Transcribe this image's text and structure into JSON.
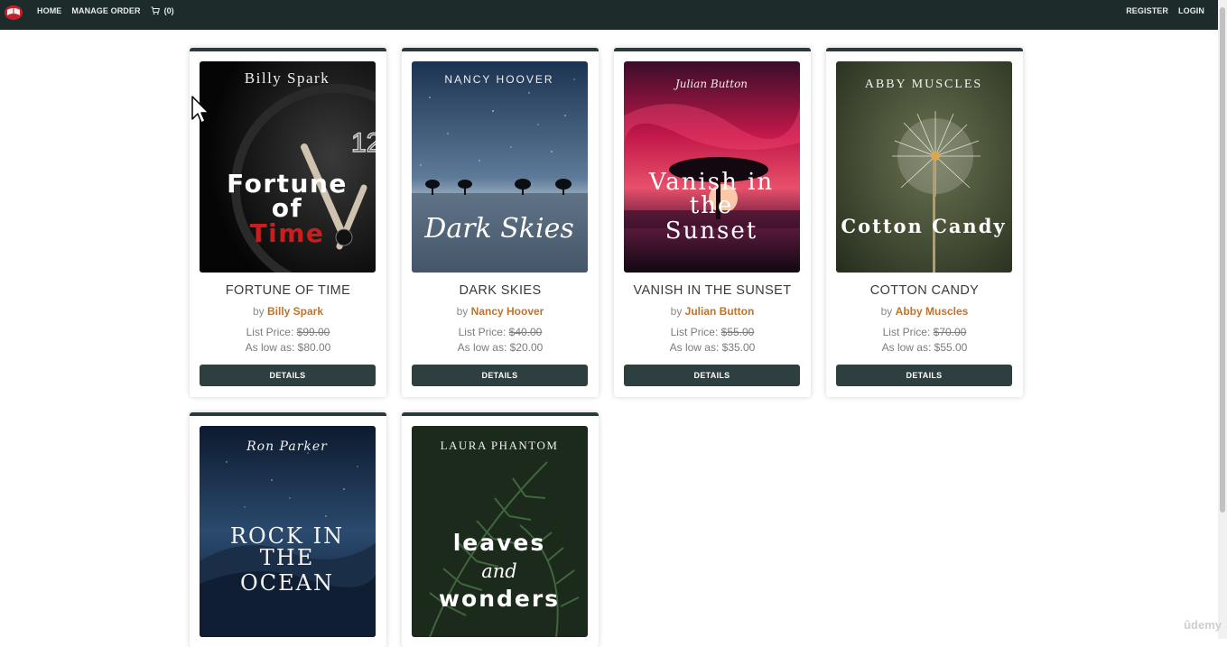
{
  "nav": {
    "home": "HOME",
    "manage_order": "MANAGE ORDER",
    "cart_count": "(0)",
    "register": "REGISTER",
    "login": "LOGIN"
  },
  "books": [
    {
      "title": "FORTUNE OF TIME",
      "by": "by",
      "author": "Billy Spark",
      "list_label": "List Price:",
      "list_price": "$99.00",
      "low_label": "As low as:",
      "low_price": "$80.00",
      "button": "DETAILS",
      "cover": {
        "author": "Billy Spark",
        "lines": [
          "Fortune",
          "of",
          "Time"
        ]
      }
    },
    {
      "title": "DARK SKIES",
      "by": "by",
      "author": "Nancy Hoover",
      "list_label": "List Price:",
      "list_price": "$40.00",
      "low_label": "As low as:",
      "low_price": "$20.00",
      "button": "DETAILS",
      "cover": {
        "author": "NANCY HOOVER",
        "lines": [
          "Dark Skies"
        ]
      }
    },
    {
      "title": "VANISH IN THE SUNSET",
      "by": "by",
      "author": "Julian Button",
      "list_label": "List Price:",
      "list_price": "$55.00",
      "low_label": "As low as:",
      "low_price": "$35.00",
      "button": "DETAILS",
      "cover": {
        "author": "Julian Button",
        "lines": [
          "Vanish in",
          "the",
          "Sunset"
        ]
      }
    },
    {
      "title": "COTTON CANDY",
      "by": "by",
      "author": "Abby Muscles",
      "list_label": "List Price:",
      "list_price": "$70.00",
      "low_label": "As low as:",
      "low_price": "$55.00",
      "button": "DETAILS",
      "cover": {
        "author": "ABBY MUSCLES",
        "lines": [
          "Cotton Candy"
        ]
      }
    },
    {
      "cover": {
        "author": "Ron Parker",
        "lines": [
          "ROCK IN",
          "THE",
          "OCEAN"
        ]
      }
    },
    {
      "cover": {
        "author": "LAURA PHANTOM",
        "lines": [
          "leaves",
          "and",
          "wonders"
        ]
      }
    }
  ],
  "watermark": "ûdemy",
  "colors": {
    "nav_bg": "#1e2b2b",
    "button_bg": "#2e3f3f",
    "author_link": "#c0732a"
  }
}
